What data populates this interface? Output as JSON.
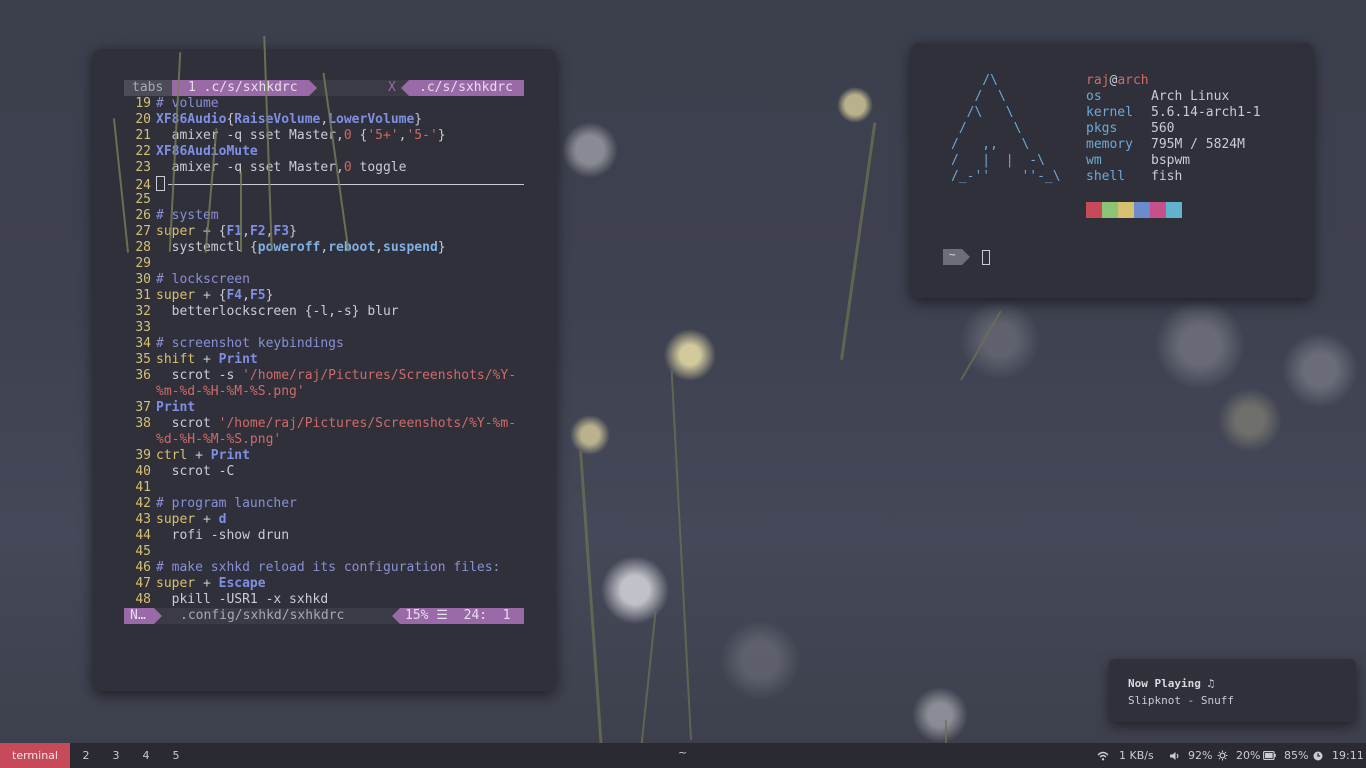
{
  "terminal": {
    "tabline": {
      "tabs_label": "tabs",
      "current_tab": "1 .c/s/sxhkdrc",
      "close": "X",
      "right_tab": ".c/s/sxhkdrc"
    },
    "lines": [
      {
        "n": "19",
        "segs": [
          [
            "c-comment",
            "# volume"
          ]
        ]
      },
      {
        "n": "20",
        "segs": [
          [
            "c-kw",
            "XF86Audio"
          ],
          [
            "c-tx",
            "{"
          ],
          [
            "c-kw",
            "RaiseVolume"
          ],
          [
            "c-tx",
            ","
          ],
          [
            "c-kw",
            "LowerVolume"
          ],
          [
            "c-tx",
            "}"
          ]
        ]
      },
      {
        "n": "21",
        "segs": [
          [
            "c-tx",
            "  amixer -q sset Master,"
          ],
          [
            "c-num",
            "0"
          ],
          [
            "c-tx",
            " {"
          ],
          [
            "c-str",
            "'5+'"
          ],
          [
            "c-tx",
            ","
          ],
          [
            "c-str",
            "'5-'"
          ],
          [
            "c-tx",
            "}"
          ]
        ]
      },
      {
        "n": "22",
        "segs": [
          [
            "c-kw",
            "XF86AudioMute"
          ]
        ]
      },
      {
        "n": "23",
        "segs": [
          [
            "c-tx",
            "  amixer -q sset Master,"
          ],
          [
            "c-num",
            "0"
          ],
          [
            "c-tx",
            " toggle"
          ]
        ]
      },
      {
        "n": "24",
        "segs": [],
        "cursor": true
      },
      {
        "n": "25",
        "segs": []
      },
      {
        "n": "26",
        "segs": [
          [
            "c-comment",
            "# system"
          ]
        ]
      },
      {
        "n": "27",
        "segs": [
          [
            "c-key",
            "super"
          ],
          [
            "c-tx",
            " + {"
          ],
          [
            "c-kw",
            "F1"
          ],
          [
            "c-tx",
            ","
          ],
          [
            "c-kw",
            "F2"
          ],
          [
            "c-tx",
            ","
          ],
          [
            "c-kw",
            "F3"
          ],
          [
            "c-tx",
            "}"
          ]
        ]
      },
      {
        "n": "28",
        "segs": [
          [
            "c-tx",
            "  systemctl {"
          ],
          [
            "c-fn",
            "poweroff"
          ],
          [
            "c-tx",
            ","
          ],
          [
            "c-fn",
            "reboot"
          ],
          [
            "c-tx",
            ","
          ],
          [
            "c-fn",
            "suspend"
          ],
          [
            "c-tx",
            "}"
          ]
        ]
      },
      {
        "n": "29",
        "segs": []
      },
      {
        "n": "30",
        "segs": [
          [
            "c-comment",
            "# lockscreen"
          ]
        ]
      },
      {
        "n": "31",
        "segs": [
          [
            "c-key",
            "super"
          ],
          [
            "c-tx",
            " + {"
          ],
          [
            "c-kw",
            "F4"
          ],
          [
            "c-tx",
            ","
          ],
          [
            "c-kw",
            "F5"
          ],
          [
            "c-tx",
            "}"
          ]
        ]
      },
      {
        "n": "32",
        "segs": [
          [
            "c-tx",
            "  betterlockscreen {-l,-s} blur"
          ]
        ]
      },
      {
        "n": "33",
        "segs": []
      },
      {
        "n": "34",
        "segs": [
          [
            "c-comment",
            "# screenshot keybindings"
          ]
        ]
      },
      {
        "n": "35",
        "segs": [
          [
            "c-key",
            "shift"
          ],
          [
            "c-tx",
            " + "
          ],
          [
            "c-kw",
            "Print"
          ]
        ]
      },
      {
        "n": "36",
        "segs": [
          [
            "c-tx",
            "  scrot -s "
          ],
          [
            "c-str",
            "'/home/raj/Pictures/Screenshots/%Y-"
          ]
        ]
      },
      {
        "n": "",
        "segs": [
          [
            "c-str",
            "%m-%d-%H-%M-%S.png'"
          ]
        ]
      },
      {
        "n": "37",
        "segs": [
          [
            "c-kw",
            "Print"
          ]
        ]
      },
      {
        "n": "38",
        "segs": [
          [
            "c-tx",
            "  scrot "
          ],
          [
            "c-str",
            "'/home/raj/Pictures/Screenshots/%Y-%m-"
          ]
        ]
      },
      {
        "n": "",
        "segs": [
          [
            "c-str",
            "%d-%H-%M-%S.png'"
          ]
        ]
      },
      {
        "n": "39",
        "segs": [
          [
            "c-key",
            "ctrl"
          ],
          [
            "c-tx",
            " + "
          ],
          [
            "c-kw",
            "Print"
          ]
        ]
      },
      {
        "n": "40",
        "segs": [
          [
            "c-tx",
            "  scrot -C"
          ]
        ]
      },
      {
        "n": "41",
        "segs": []
      },
      {
        "n": "42",
        "segs": [
          [
            "c-comment",
            "# program launcher"
          ]
        ]
      },
      {
        "n": "43",
        "segs": [
          [
            "c-key",
            "super"
          ],
          [
            "c-tx",
            " + "
          ],
          [
            "c-kw",
            "d"
          ]
        ]
      },
      {
        "n": "44",
        "segs": [
          [
            "c-tx",
            "  rofi -show drun"
          ]
        ]
      },
      {
        "n": "45",
        "segs": []
      },
      {
        "n": "46",
        "segs": [
          [
            "c-comment",
            "# make sxhkd reload its configuration files:"
          ]
        ]
      },
      {
        "n": "47",
        "segs": [
          [
            "c-key",
            "super"
          ],
          [
            "c-tx",
            " + "
          ],
          [
            "c-kw",
            "Escape"
          ]
        ]
      },
      {
        "n": "48",
        "segs": [
          [
            "c-tx",
            "  pkill -USR1 -x sxhkd"
          ]
        ]
      }
    ],
    "statusline": {
      "mode": "N…",
      "file": ".config/sxhkd/sxhkdrc",
      "position": "15% ☰  24:  1"
    }
  },
  "neofetch": {
    "logo": "    /\\\n   /  \\\n  /\\   \\\n /      \\\n/   ,,   \\\n/   |  |  -\\\n/_-''    ''-_\\",
    "user": "raj",
    "at": "@",
    "host": "arch",
    "rows": [
      {
        "k": "os",
        "v": "Arch Linux"
      },
      {
        "k": "kernel",
        "v": "5.6.14-arch1-1"
      },
      {
        "k": "pkgs",
        "v": "560"
      },
      {
        "k": "memory",
        "v": "795M / 5824M"
      },
      {
        "k": "wm",
        "v": "bspwm"
      },
      {
        "k": "shell",
        "v": "fish"
      }
    ],
    "palette": [
      "#c74a5b",
      "#8cc474",
      "#d7c06f",
      "#6a8ccc",
      "#c7508b",
      "#5fb3cc"
    ],
    "prompt_symbol": "~"
  },
  "notification": {
    "title": "Now Playing ♫",
    "body": "Slipknot - Snuff"
  },
  "bar": {
    "workspaces": [
      "terminal",
      "2",
      "3",
      "4",
      "5"
    ],
    "active_workspace": "terminal",
    "center": "~",
    "network": "1 KB/s",
    "volume": "92%",
    "brightness": "20%",
    "battery": "85%",
    "time": "19:11",
    "accent": "#c74a5b"
  }
}
